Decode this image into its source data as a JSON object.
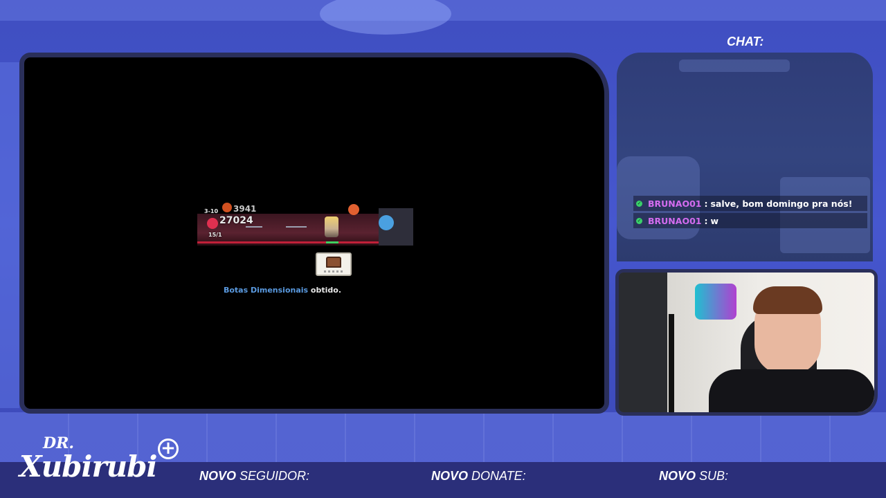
{
  "overlay": {
    "chat_title": "CHAT:",
    "logo_dr": "DR.",
    "logo_name": "Xubirubi",
    "logo_plus": "+",
    "alerts": [
      {
        "bold": "NOVO",
        "rest": " SEGUIDOR:"
      },
      {
        "bold": "NOVO",
        "rest": " DONATE:"
      },
      {
        "bold": "NOVO",
        "rest": " SUB:"
      }
    ]
  },
  "game": {
    "stage": "3-10",
    "gold_value": "3941",
    "damage_value": "27024",
    "counter": "15/1",
    "loot_item": "Botas Dimensionais",
    "loot_suffix": " obtido."
  },
  "chat": {
    "messages": [
      {
        "user": "BRUNAO01",
        "text": "salve, bom domingo pra nós!"
      },
      {
        "user": "BRUNAO01",
        "text": "w"
      }
    ]
  },
  "colors": {
    "background": "#4657cf",
    "bottom_bar": "#2b2f7a",
    "chat_username": "#d46cf0",
    "loot_item": "#5a9ae0",
    "verified_badge": "#3ad06a"
  }
}
